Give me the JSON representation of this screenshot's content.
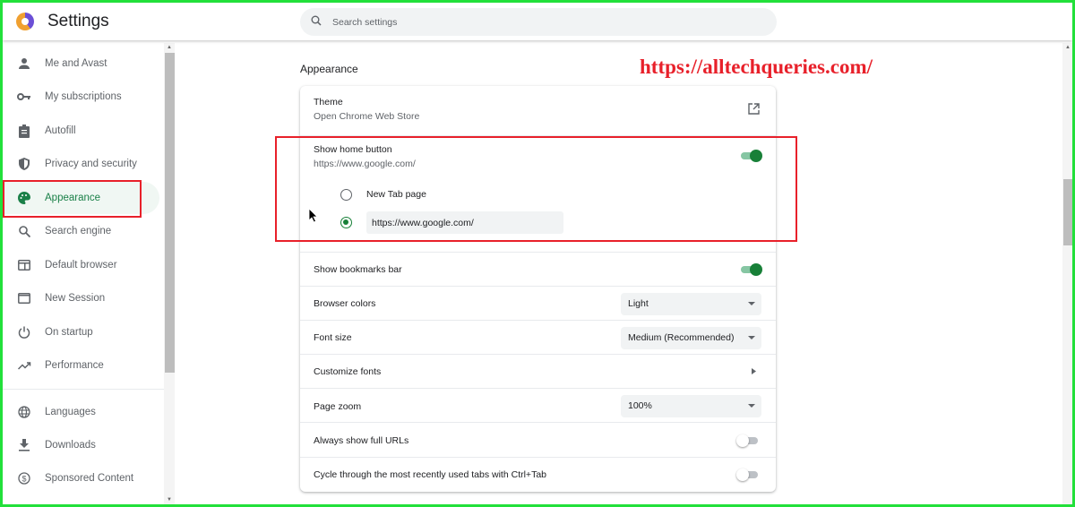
{
  "header": {
    "title": "Settings",
    "search_placeholder": "Search settings"
  },
  "sidebar": {
    "items": [
      {
        "label": "Me and Avast",
        "icon": "person-icon"
      },
      {
        "label": "My subscriptions",
        "icon": "key-icon"
      },
      {
        "label": "Autofill",
        "icon": "clipboard-icon"
      },
      {
        "label": "Privacy and security",
        "icon": "shield-icon"
      },
      {
        "label": "Appearance",
        "icon": "palette-icon",
        "active": true
      },
      {
        "label": "Search engine",
        "icon": "search-icon"
      },
      {
        "label": "Default browser",
        "icon": "browser-icon"
      },
      {
        "label": "New Session",
        "icon": "window-icon"
      },
      {
        "label": "On startup",
        "icon": "power-icon"
      },
      {
        "label": "Performance",
        "icon": "trending-icon"
      },
      {
        "label": "Languages",
        "icon": "globe-icon"
      },
      {
        "label": "Downloads",
        "icon": "download-icon"
      },
      {
        "label": "Sponsored Content",
        "icon": "dollar-icon"
      }
    ]
  },
  "main": {
    "section_title": "Appearance",
    "theme": {
      "label": "Theme",
      "sub": "Open Chrome Web Store"
    },
    "home_button": {
      "label": "Show home button",
      "sub": "https://www.google.com/",
      "enabled": true,
      "options": [
        {
          "label": "New Tab page",
          "checked": false
        },
        {
          "value": "https://www.google.com/",
          "checked": true
        }
      ]
    },
    "bookmarks_bar": {
      "label": "Show bookmarks bar",
      "enabled": true
    },
    "browser_colors": {
      "label": "Browser colors",
      "value": "Light"
    },
    "font_size": {
      "label": "Font size",
      "value": "Medium (Recommended)"
    },
    "customize_fonts": {
      "label": "Customize fonts"
    },
    "page_zoom": {
      "label": "Page zoom",
      "value": "100%"
    },
    "full_urls": {
      "label": "Always show full URLs",
      "enabled": false
    },
    "cycle_tabs": {
      "label": "Cycle through the most recently used tabs with Ctrl+Tab",
      "enabled": false
    }
  },
  "watermark": "https://alltechqueries.com/",
  "colors": {
    "accent": "#188038",
    "highlight": "#e8202a",
    "frame": "#22e03a"
  }
}
